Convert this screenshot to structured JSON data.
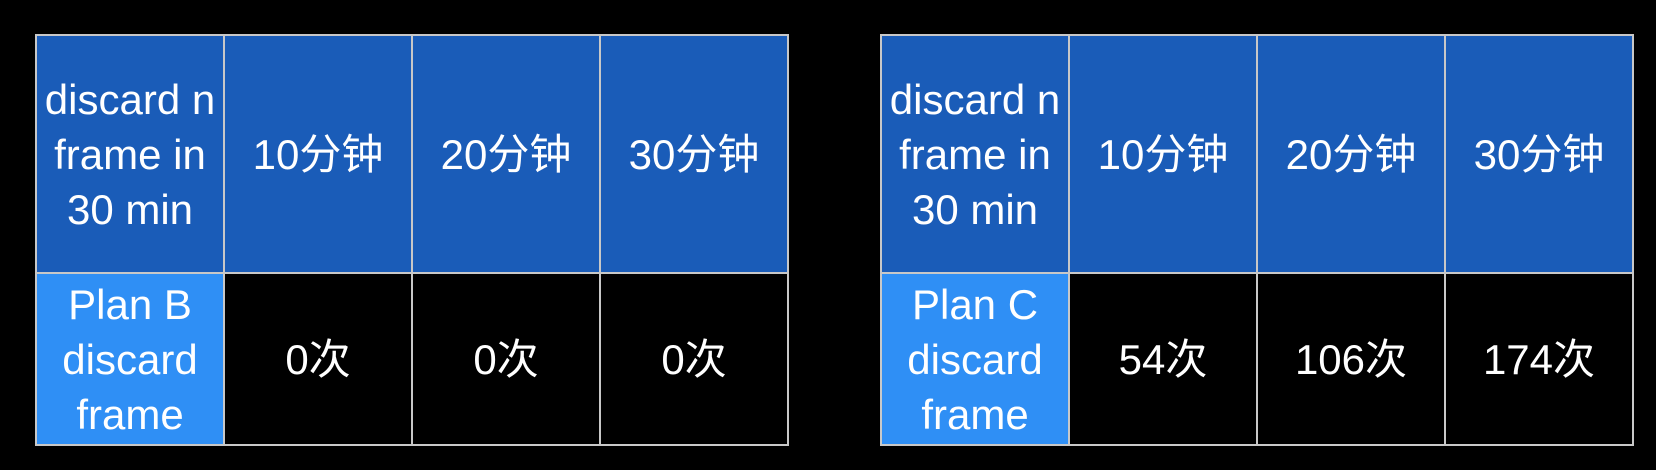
{
  "tables": [
    {
      "header": {
        "corner": "discard n frame in 30 min",
        "columns": [
          "10分钟",
          "20分钟",
          "30分钟"
        ]
      },
      "row": {
        "label": "Plan B discard frame",
        "values": [
          "0次",
          "0次",
          "0次"
        ]
      }
    },
    {
      "header": {
        "corner": "discard n frame in 30 min",
        "columns": [
          "10分钟",
          "20分钟",
          "30分钟"
        ]
      },
      "row": {
        "label": "Plan C discard frame",
        "values": [
          "54次",
          "106次",
          "174次"
        ]
      }
    }
  ],
  "colors": {
    "header_bg": "#1a5cb8",
    "row_label_bg": "#2f8ff5",
    "cell_bg": "#000000",
    "border": "#c8c8c8",
    "text": "#ffffff"
  }
}
